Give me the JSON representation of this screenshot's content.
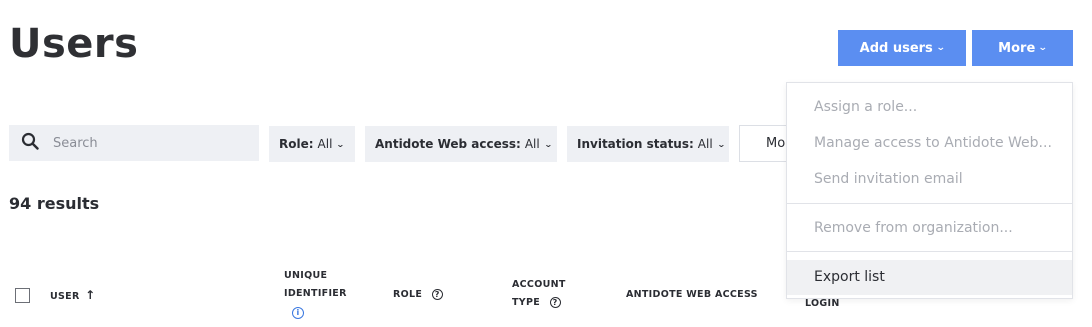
{
  "page": {
    "title": "Users"
  },
  "header_actions": {
    "add_users": "Add users",
    "more": "More"
  },
  "filters": {
    "search_placeholder": "Search",
    "role_label": "Role:",
    "role_value": "All",
    "web_label": "Antidote Web access:",
    "web_value": "All",
    "invitation_label": "Invitation status:",
    "invitation_value": "All",
    "more_filters_partial": "Mo"
  },
  "results": {
    "count_text": "94 results"
  },
  "table": {
    "headers": {
      "user": "USER",
      "user_sort": "↑",
      "unique_line1": "UNIQUE",
      "unique_line2": "IDENTIFIER",
      "role": "ROLE",
      "account_line1": "ACCOUNT",
      "account_line2": "TYPE",
      "web_access": "ANTIDOTE WEB ACCESS",
      "login": "LOGIN"
    }
  },
  "more_menu": {
    "items": [
      {
        "label": "Assign a role...",
        "state": "disabled"
      },
      {
        "label": "Manage access to Antidote Web...",
        "state": "disabled"
      },
      {
        "label": "Send invitation email",
        "state": "disabled"
      },
      {
        "label": "Remove from organization...",
        "state": "disabled"
      },
      {
        "label": "Export list",
        "state": "hovered"
      }
    ]
  },
  "colors": {
    "accent": "#5b8ef1",
    "filter_bg": "#eef0f4",
    "disabled_text": "#a9acb3",
    "info_blue": "#3a78e0"
  },
  "icons": {
    "search": "search-icon",
    "chevron": "chevron-down-icon",
    "help": "help-circle-icon",
    "info": "info-icon",
    "sort": "sort-ascending-icon"
  }
}
